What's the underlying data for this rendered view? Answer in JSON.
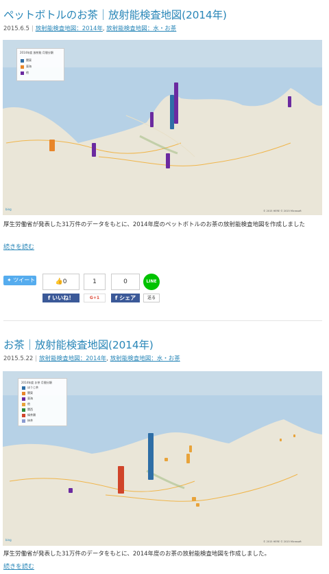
{
  "posts": [
    {
      "title": "ペットボトルのお茶｜放射能検査地図(2014年)",
      "date": "2015.6.5",
      "categories": [
        "放射能検査地図：2014年",
        "放射能検査地図：水・お茶"
      ],
      "map": {
        "legend_title": "2014年度 放射能 月間分類",
        "legend": [
          {
            "label": "関東",
            "color": "#2e6ea6"
          },
          {
            "label": "東海",
            "color": "#e8862a"
          },
          {
            "label": "他",
            "color": "#6b2aa0"
          }
        ],
        "logo": "bing",
        "copyright": "© 2015 HERE  © 2015 Microsoft"
      },
      "excerpt": "厚生労働省が発表した31万件のデータをもとに、2014年度のペットボトルのお茶の放射能検査地図を作成しました",
      "read_more": "続きを読む"
    },
    {
      "title": "お茶｜放射能検査地図(2014年)",
      "date": "2015.5.22",
      "categories": [
        "放射能検査地図：2014年",
        "放射能検査地図：水・お茶"
      ],
      "map": {
        "legend_title": "2014年度 お茶 月間分類",
        "legend": [
          {
            "label": "ほうじ茶",
            "color": "#2e6ea6"
          },
          {
            "label": "関東",
            "color": "#e8862a"
          },
          {
            "label": "東海",
            "color": "#6b2aa0"
          },
          {
            "label": "他",
            "color": "#e8a33a"
          },
          {
            "label": "関西",
            "color": "#2a8a3a"
          },
          {
            "label": "緑茶類",
            "color": "#d0442a"
          },
          {
            "label": "抹茶",
            "color": "#8a9ad0"
          }
        ],
        "logo": "bing",
        "copyright": "© 2015 HERE  © 2015 Microsoft"
      },
      "excerpt": "厚生労働省が発表した31万件のデータをもとに、2014年度のお茶の放射能検査地図を作成しました。",
      "read_more": "続きを読む"
    }
  ],
  "share": {
    "tweet": "ツイート",
    "like_count": "0",
    "g_count": "1",
    "share_count": "0",
    "like_label": "いいね！",
    "gplus_label": "G+1",
    "share_label": "シェア",
    "line_label": "LINE",
    "send_label": "送る"
  }
}
